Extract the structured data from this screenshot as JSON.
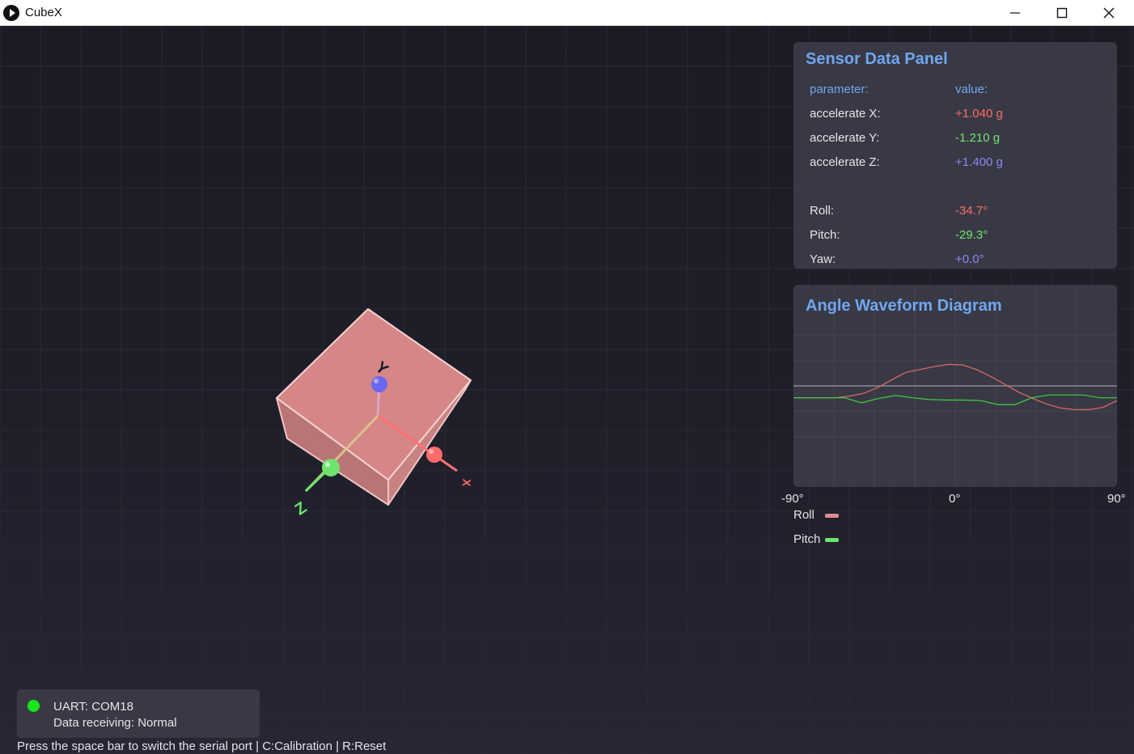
{
  "window": {
    "title": "CubeX"
  },
  "sensor_panel": {
    "title": "Sensor Data Panel",
    "header": {
      "parameter": "parameter:",
      "value": "value:"
    },
    "accel": [
      {
        "label": "accelerate X:",
        "value": "+1.040 g",
        "color": "#ff6b6b"
      },
      {
        "label": "accelerate Y:",
        "value": "-1.210 g",
        "color": "#6ee46e"
      },
      {
        "label": "accelerate Z:",
        "value": "+1.400 g",
        "color": "#8a86f5"
      }
    ],
    "angles": [
      {
        "label": "Roll:",
        "value": "-34.7°",
        "color": "#ff6b6b"
      },
      {
        "label": "Pitch:",
        "value": "-29.3°",
        "color": "#6ee46e"
      },
      {
        "label": "Yaw:",
        "value": "+0.0°",
        "color": "#8a86f5"
      }
    ]
  },
  "cube": {
    "axis_labels": {
      "x": "X",
      "y": "Y",
      "z": "Z"
    },
    "face_color": "#e08c8c",
    "axis_colors": {
      "x": "#ff6b6b",
      "y": "#6a67f0",
      "z": "#6ee46e"
    }
  },
  "waveform": {
    "title": "Angle Waveform Diagram",
    "ticks": {
      "left": "-90°",
      "mid": "0°",
      "right": "90°"
    },
    "legend": [
      {
        "label": "Roll",
        "color": "#e08c8c"
      },
      {
        "label": "Pitch",
        "color": "#6ee46e"
      }
    ]
  },
  "chart_data": {
    "type": "line",
    "title": "Angle Waveform Diagram",
    "ylim": [
      -90,
      90
    ],
    "grid": true,
    "legend_position": "bottom-left",
    "x": [
      0,
      5,
      10,
      15,
      18,
      20,
      22,
      25,
      30,
      35,
      40,
      45,
      50,
      52,
      55,
      57,
      60,
      62,
      65,
      68,
      70,
      75,
      80,
      85,
      90,
      95,
      100
    ],
    "series": [
      {
        "name": "Roll",
        "color": "#e08c8c",
        "values": [
          -21,
          -21,
          -21,
          -21,
          -18,
          -13,
          -3,
          11,
          24,
          29,
          34,
          38,
          37,
          29,
          17,
          3,
          -11,
          -22,
          -32,
          -39,
          -42,
          -42,
          -38,
          -26
        ]
      },
      {
        "name": "Pitch",
        "color": "#6ee46e",
        "values": [
          -21,
          -21,
          -21,
          -21,
          -30,
          -22,
          -17,
          -21,
          -24,
          -25,
          -25,
          -26,
          -33,
          -33,
          -21,
          -16,
          -16,
          -16,
          -21,
          -21
        ]
      }
    ]
  },
  "status": {
    "uart": "UART: COM18",
    "receiving": "Data receiving: Normal",
    "dot_color": "#19e619",
    "hint": "Press the space bar to switch the serial port | C:Calibration | R:Reset"
  }
}
